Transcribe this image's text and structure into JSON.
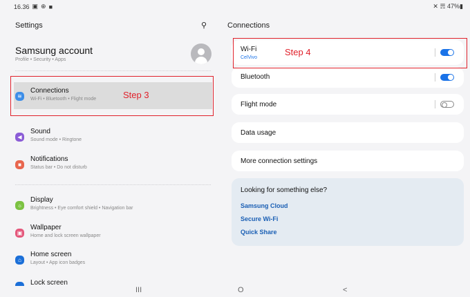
{
  "status_bar": {
    "time": "16.36",
    "icons_left": [
      "image-icon",
      "vpn-icon",
      "notification-icon"
    ],
    "right": "✕ ☴ 47%▮"
  },
  "left": {
    "title": "Settings",
    "account": {
      "title": "Samsung account",
      "subtitle": "Profile  •  Security  •  Apps"
    },
    "items": [
      {
        "title": "Connections",
        "subtitle": "Wi-Fi  •  Bluetooth  •  Flight mode",
        "icon": "wifi-icon",
        "icon_color": "#3d8ee8",
        "glyph": "≋"
      },
      {
        "title": "Sound",
        "subtitle": "Sound mode  •  Ringtone",
        "icon": "speaker-icon",
        "icon_color": "#8b5cd6",
        "glyph": "◀"
      },
      {
        "title": "Notifications",
        "subtitle": "Status bar  •  Do not disturb",
        "icon": "bell-icon",
        "icon_color": "#e8664e",
        "glyph": "■"
      },
      {
        "title": "Display",
        "subtitle": "Brightness  •  Eye comfort shield  •  Navigation bar",
        "icon": "sun-icon",
        "icon_color": "#7cc242",
        "glyph": "☼"
      },
      {
        "title": "Wallpaper",
        "subtitle": "Home and lock screen wallpaper",
        "icon": "image-icon",
        "icon_color": "#e4577b",
        "glyph": "▣"
      },
      {
        "title": "Home screen",
        "subtitle": "Layout  •  App icon badges",
        "icon": "home-icon",
        "icon_color": "#1b6fd8",
        "glyph": "⌂"
      }
    ],
    "cutoff_item": "Lock screen"
  },
  "right": {
    "title": "Connections",
    "wifi": {
      "label": "Wi-Fi",
      "network": "CelVivo",
      "state": "on"
    },
    "bluetooth": {
      "label": "Bluetooth",
      "state": "on"
    },
    "flight": {
      "label": "Flight mode",
      "state": "off"
    },
    "data_usage": "Data usage",
    "more": "More connection settings",
    "suggest": {
      "title": "Looking for something else?",
      "links": [
        "Samsung Cloud",
        "Secure Wi-Fi",
        "Quick Share"
      ]
    }
  },
  "annotations": {
    "step3": "Step 3",
    "step4": "Step 4"
  },
  "colors": {
    "annotation": "#e0202a",
    "accent": "#1a73e8",
    "link": "#1a5fb4"
  },
  "nav": {
    "recents": "III",
    "home": "O",
    "back": "<"
  }
}
